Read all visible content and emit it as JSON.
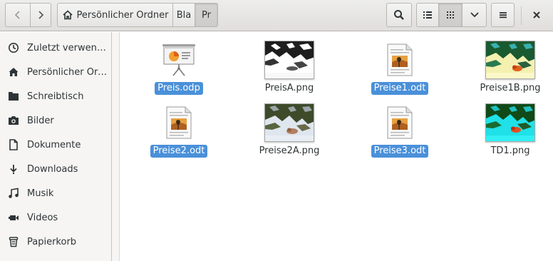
{
  "toolbar": {
    "path": {
      "home_label": "Persönlicher Ordner",
      "seg2": "Bla",
      "seg3": "Pr"
    }
  },
  "sidebar": {
    "items": [
      {
        "label": "Zuletzt verwendet",
        "icon": "clock-icon"
      },
      {
        "label": "Persönlicher Ordner",
        "icon": "home-icon"
      },
      {
        "label": "Schreibtisch",
        "icon": "folder-icon"
      },
      {
        "label": "Bilder",
        "icon": "camera-icon"
      },
      {
        "label": "Dokumente",
        "icon": "document-icon"
      },
      {
        "label": "Downloads",
        "icon": "download-icon"
      },
      {
        "label": "Musik",
        "icon": "music-icon"
      },
      {
        "label": "Videos",
        "icon": "video-icon"
      },
      {
        "label": "Papierkorb",
        "icon": "trash-icon"
      }
    ]
  },
  "files": [
    {
      "name": "Preis.odp",
      "type": "presentation",
      "selected": true
    },
    {
      "name": "PreisA.png",
      "type": "image-bw",
      "selected": false
    },
    {
      "name": "Preise1.odt",
      "type": "document",
      "selected": true
    },
    {
      "name": "Preise1B.png",
      "type": "image-yellow",
      "selected": false
    },
    {
      "name": "Preise2.odt",
      "type": "document",
      "selected": true
    },
    {
      "name": "Preise2A.png",
      "type": "image-photo",
      "selected": false
    },
    {
      "name": "Preise3.odt",
      "type": "document",
      "selected": true
    },
    {
      "name": "TD1.png",
      "type": "image-cyan",
      "selected": false
    }
  ],
  "colors": {
    "selection": "#4a90d9",
    "sidebar_bg": "#f6f5f4"
  }
}
